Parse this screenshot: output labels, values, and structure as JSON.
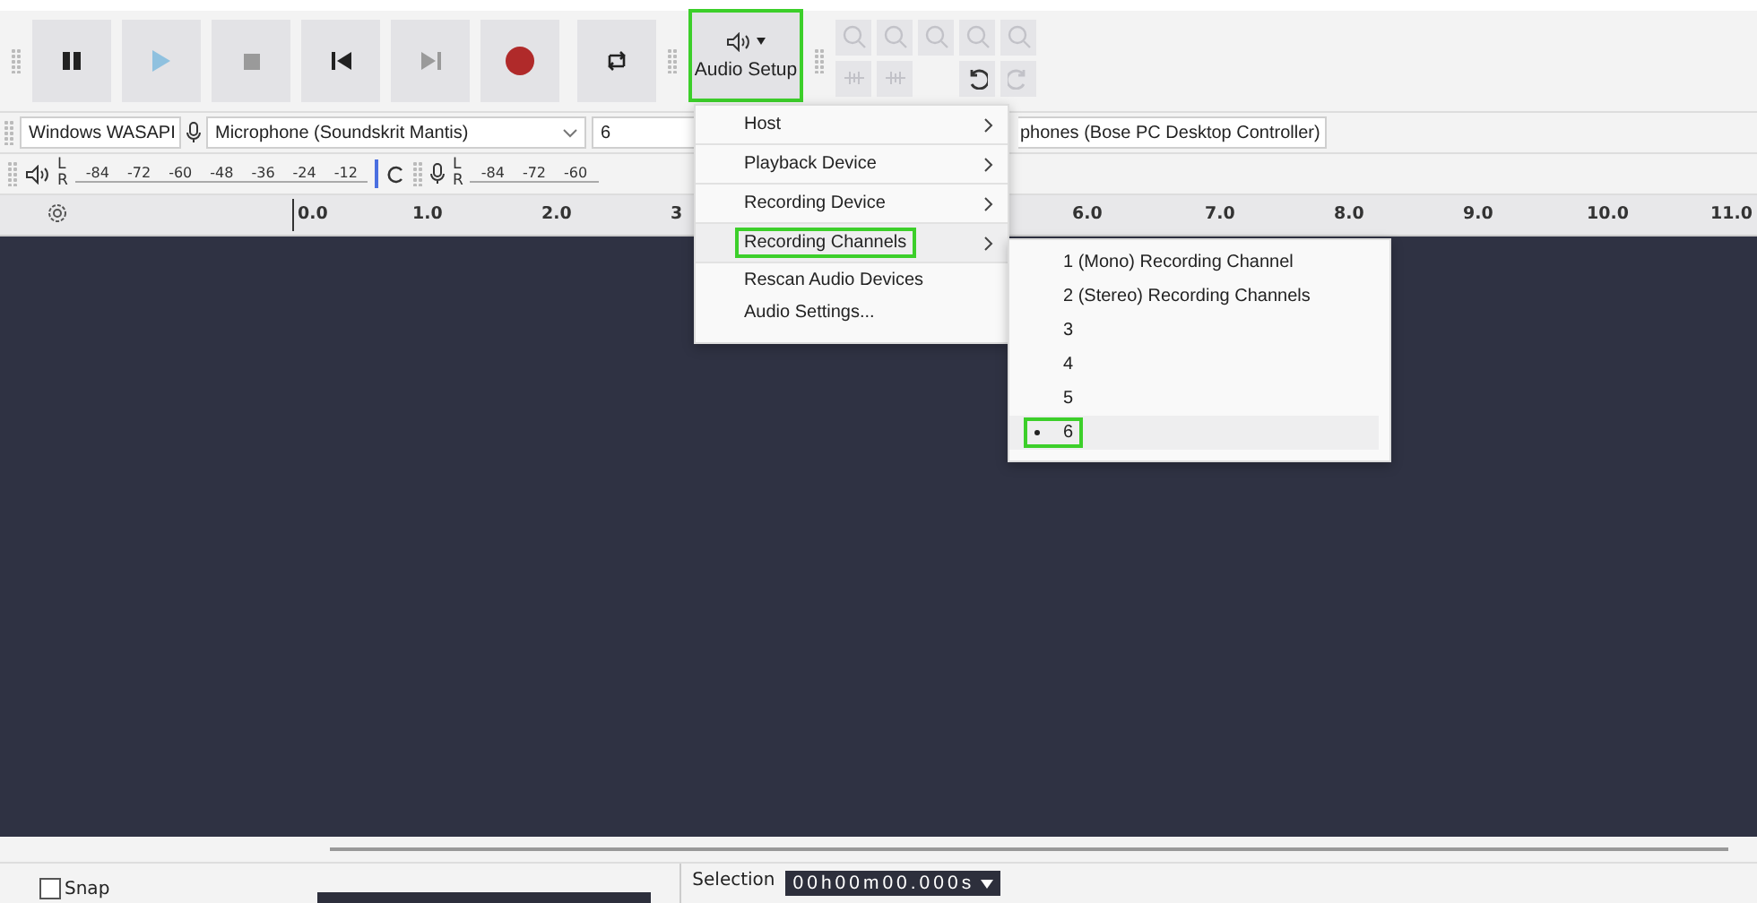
{
  "transport": [
    {
      "kind": "pause",
      "disabled": false
    },
    {
      "kind": "play",
      "disabled": true
    },
    {
      "kind": "stop",
      "disabled": true
    },
    {
      "kind": "skip-start",
      "disabled": false
    },
    {
      "kind": "skip-end",
      "disabled": true
    },
    {
      "kind": "record",
      "disabled": false
    },
    {
      "kind": "loop",
      "disabled": false
    }
  ],
  "audio_setup": {
    "label": "Audio Setup",
    "highlighted": true
  },
  "edit_tools": [
    {
      "kind": "zoom-in",
      "disabled": true
    },
    {
      "kind": "zoom-out",
      "disabled": true
    },
    {
      "kind": "fit-selection",
      "disabled": true
    },
    {
      "kind": "fit-project",
      "disabled": true
    },
    {
      "kind": "zoom-toggle",
      "disabled": true
    },
    {
      "kind": "trim",
      "disabled": true
    },
    {
      "kind": "silence",
      "disabled": true
    },
    {
      "kind": "undo",
      "disabled": false
    },
    {
      "kind": "redo",
      "disabled": true
    }
  ],
  "devices": {
    "host": "Windows WASAPI",
    "recording_device": "Microphone (Soundskrit Mantis)",
    "channels": "6",
    "playback_device": "phones (Bose PC Desktop Controller)"
  },
  "playback_meter": {
    "left": "L",
    "right": "R",
    "ticks": [
      "-84",
      "-72",
      "-60",
      "-48",
      "-36",
      "-24",
      "-12"
    ]
  },
  "record_meter": {
    "left": "L",
    "right": "R",
    "ticks": [
      "-84",
      "-72",
      "-60"
    ]
  },
  "ruler": [
    "0.0",
    "1.0",
    "2.0",
    "3",
    "6.0",
    "7.0",
    "8.0",
    "9.0",
    "10.0",
    "11.0"
  ],
  "menu": [
    {
      "label": "Host",
      "submenu": true,
      "highlighted": false
    },
    {
      "label": "Playback Device",
      "submenu": true,
      "highlighted": false
    },
    {
      "label": "Recording Device",
      "submenu": true,
      "highlighted": false
    },
    {
      "label": "Recording Channels",
      "submenu": true,
      "highlighted": true
    },
    {
      "label": "Rescan Audio Devices",
      "submenu": false,
      "highlighted": false
    },
    {
      "label": "Audio Settings...",
      "submenu": false,
      "highlighted": false
    }
  ],
  "submenu": [
    {
      "label": "1 (Mono) Recording Channel",
      "selected": false,
      "highlighted": false
    },
    {
      "label": "2 (Stereo) Recording Channels",
      "selected": false,
      "highlighted": false
    },
    {
      "label": "3",
      "selected": false,
      "highlighted": false
    },
    {
      "label": "4",
      "selected": false,
      "highlighted": false
    },
    {
      "label": "5",
      "selected": false,
      "highlighted": false
    },
    {
      "label": "6",
      "selected": true,
      "highlighted": true
    }
  ],
  "bottom": {
    "snap": {
      "label": "Snap",
      "checked": false
    },
    "selection_label": "Selection",
    "selection_time": "00h00m00.000s"
  }
}
